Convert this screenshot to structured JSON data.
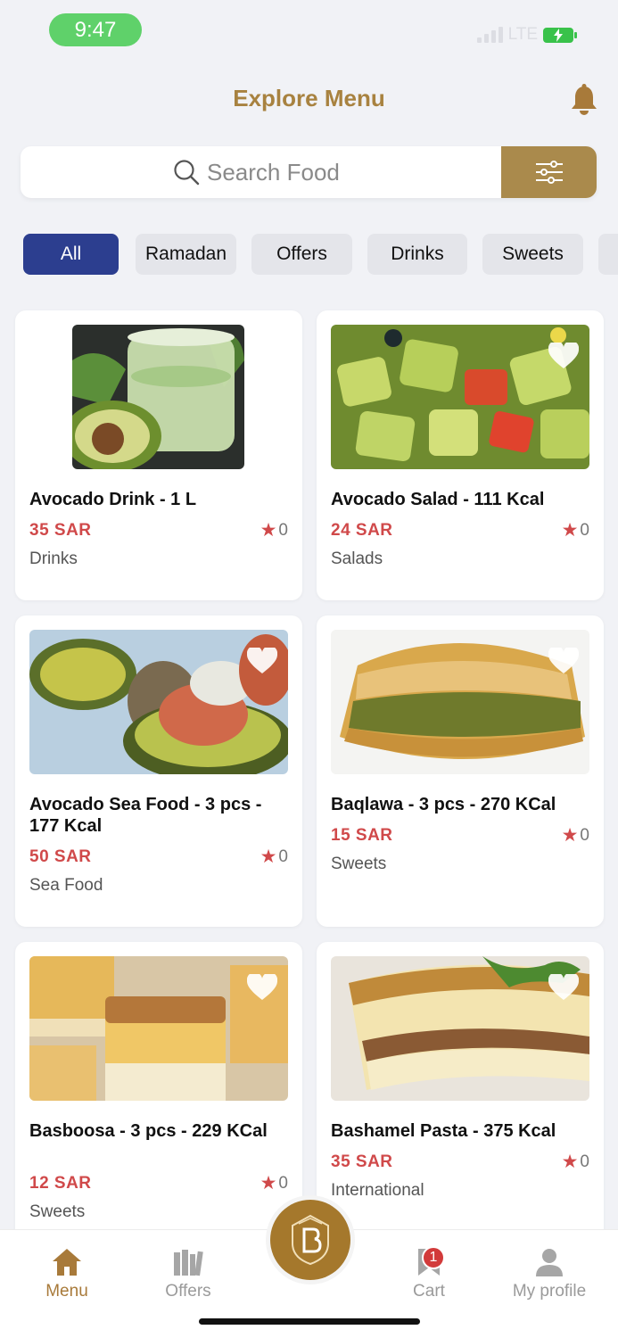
{
  "status_bar": {
    "time": "9:47",
    "network": "LTE"
  },
  "header": {
    "title": "Explore Menu"
  },
  "search": {
    "placeholder": "Search Food"
  },
  "categories": [
    {
      "label": "All",
      "active": true
    },
    {
      "label": "Ramadan",
      "active": false
    },
    {
      "label": "Offers",
      "active": false
    },
    {
      "label": "Drinks",
      "active": false
    },
    {
      "label": "Sweets",
      "active": false
    }
  ],
  "products": [
    {
      "name": "Avocado Drink - 1 L",
      "price": "35 SAR",
      "rating": "0",
      "category": "Drinks"
    },
    {
      "name": "Avocado Salad - 111 Kcal",
      "price": "24 SAR",
      "rating": "0",
      "category": "Salads"
    },
    {
      "name": "Avocado Sea Food - 3 pcs - 177 Kcal",
      "price": "50 SAR",
      "rating": "0",
      "category": "Sea Food"
    },
    {
      "name": "Baqlawa - 3 pcs - 270 KCal",
      "price": "15 SAR",
      "rating": "0",
      "category": "Sweets"
    },
    {
      "name": "Basboosa - 3 pcs - 229 KCal",
      "price": "12 SAR",
      "rating": "0",
      "category": "Sweets"
    },
    {
      "name": "Bashamel Pasta - 375 Kcal",
      "price": "35 SAR",
      "rating": "0",
      "category": "International"
    }
  ],
  "bottom_nav": {
    "menu": "Menu",
    "offers": "Offers",
    "cart": "Cart",
    "cart_badge": "1",
    "profile": "My profile"
  },
  "colors": {
    "brand": "#a88240",
    "active_chip": "#2c3e8f",
    "price": "#d0494a"
  }
}
